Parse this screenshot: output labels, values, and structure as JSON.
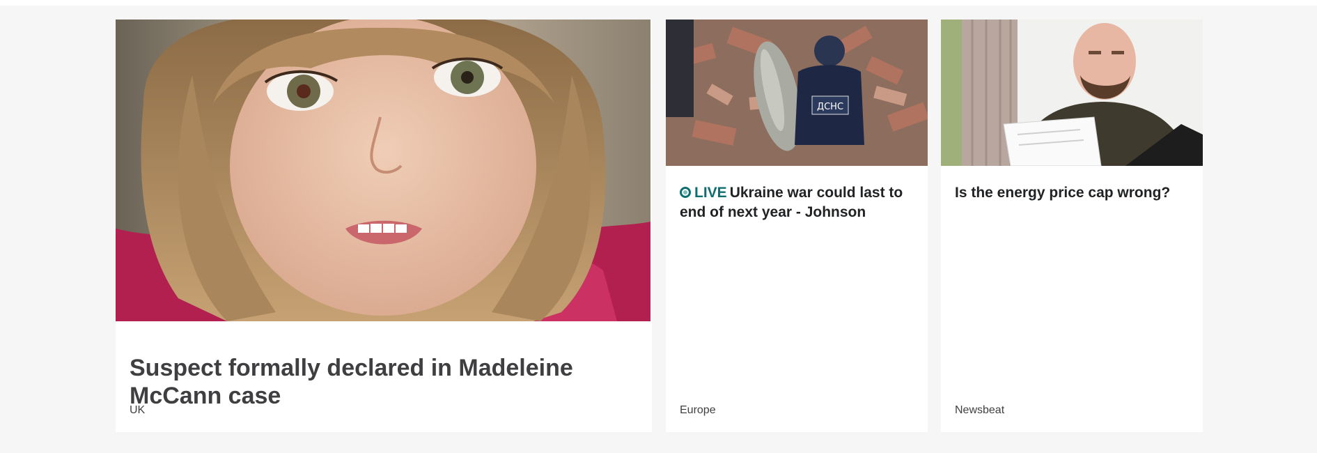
{
  "stories": [
    {
      "headline": "Suspect formally declared in Madeleine McCann case",
      "tag": "UK",
      "image": "girl-portrait-photo"
    },
    {
      "live_label": "LIVE",
      "headline": "Ukraine war could last to end of next year - Johnson",
      "tag": "Europe",
      "image": "bomb-disposal-rubble-photo",
      "badge_text": "ДСНС"
    },
    {
      "headline": "Is the energy price cap wrong?",
      "tag": "Newsbeat",
      "image": "man-reading-bill-photo"
    }
  ],
  "colors": {
    "band_background": "#f6f6f6",
    "card_background": "#ffffff",
    "live_accent": "#0d6f71",
    "headline": "#202224"
  }
}
